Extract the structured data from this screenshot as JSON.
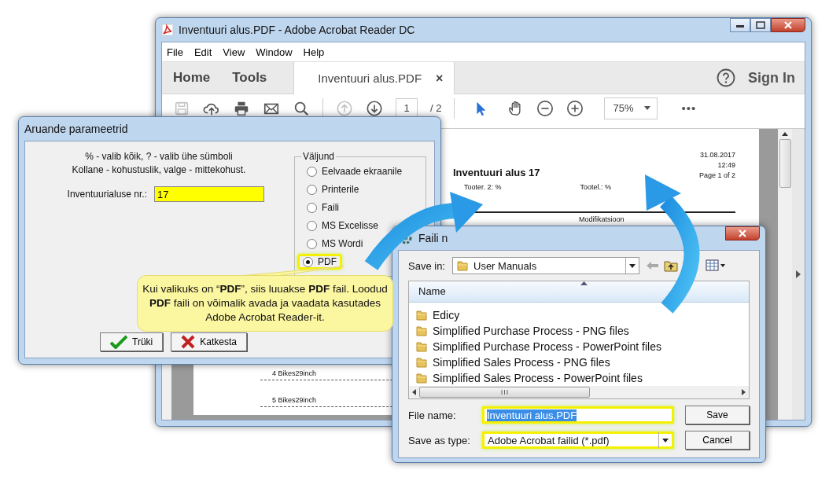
{
  "acrobat": {
    "title": "Inventuuri alus.PDF - Adobe Acrobat Reader DC",
    "menu": [
      "File",
      "Edit",
      "View",
      "Window",
      "Help"
    ],
    "nav": [
      "Home",
      "Tools"
    ],
    "tab": {
      "label": "Inventuuri alus.PDF",
      "close": "×",
      "selected": true
    },
    "sign_in": "Sign In",
    "file_tools": [
      {
        "kind": "save",
        "disabled": true
      },
      {
        "kind": "upload",
        "disabled": false
      },
      {
        "kind": "print",
        "disabled": false
      },
      {
        "kind": "mail",
        "disabled": false
      },
      {
        "kind": "search",
        "disabled": false
      }
    ],
    "page_tools": [
      {
        "kind": "prev",
        "disabled": true
      },
      {
        "kind": "next",
        "disabled": false
      }
    ],
    "page_field": "1",
    "page_total": "/ 2",
    "modes": [
      {
        "kind": "pointer",
        "selected": true
      },
      {
        "kind": "hand",
        "selected": false
      }
    ],
    "zoom": "75%",
    "more": "•••",
    "document": {
      "title": "Inventuuri alus  17",
      "filters": [
        "Tooter. 2: %",
        "Tootel.: %"
      ],
      "meta": [
        "31.08.2017",
        "12:49",
        "Page 1 of 2"
      ],
      "column": "Modifikatsioon",
      "rows": [
        "4 Bikes29inch",
        "5 Bikes29inch"
      ]
    }
  },
  "report_dialog": {
    "title": "Aruande parameetrid",
    "hints": [
      "% - valib kõik, ? - valib ühe sümboli",
      "Kollane - kohustuslik, valge - mittekohust."
    ],
    "field_label": "Inventuurialuse nr.:",
    "field_value": "17",
    "required": true,
    "output_group": "Väljund",
    "outputs": [
      {
        "label": "Eelvaade ekraanile",
        "selected": false,
        "highlighted": false
      },
      {
        "label": "Printerile",
        "selected": false,
        "highlighted": false
      },
      {
        "label": "Faili",
        "selected": false,
        "highlighted": false
      },
      {
        "label": "MS Excelisse",
        "selected": false,
        "highlighted": false
      },
      {
        "label": "MS Wordi",
        "selected": false,
        "highlighted": false
      },
      {
        "label": "PDF",
        "selected": true,
        "highlighted": true
      }
    ],
    "buttons": [
      {
        "kind": "ok",
        "label": "Trüki"
      },
      {
        "kind": "cancel",
        "label": "Katkesta"
      }
    ]
  },
  "save_dialog": {
    "title": "Faili n",
    "save_in_label": "Save in:",
    "save_in": "User Manuals",
    "column": "Name",
    "items": [
      "Edicy",
      "Simplified Purchase Process - PNG files",
      "Simplified Purchase Process - PowerPoint files",
      "Simplified Sales Process - PNG files",
      "Simplified Sales Process - PowerPoint files"
    ],
    "file_name_label": "File name:",
    "file_name": {
      "value": "Inventuuri alus.PDF",
      "highlighted": true
    },
    "type_label": "Save as type:",
    "type": {
      "value": "Adobe Acrobat failid (*.pdf)",
      "highlighted": true
    },
    "buttons": [
      "Save",
      "Cancel"
    ]
  },
  "callout": {
    "text": "Kui valikuks on “**PDF**”, siis luuakse **PDF** fail. Loodud **PDF** faili on võimalik avada ja vaadata kasutades Adobe Acrobat Reader-it."
  }
}
